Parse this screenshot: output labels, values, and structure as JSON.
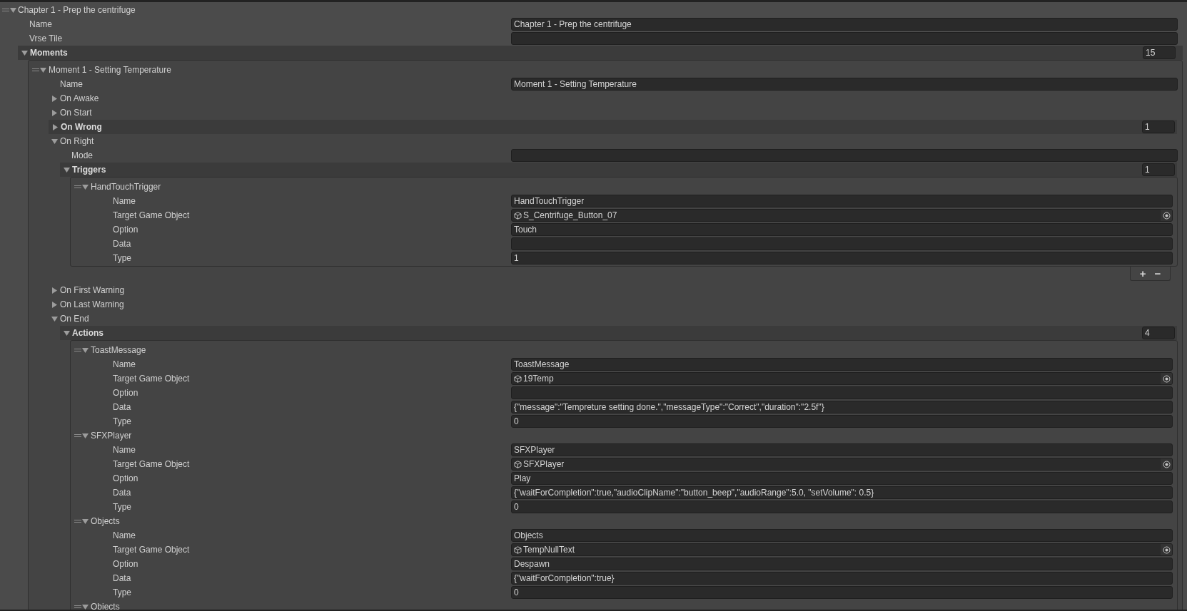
{
  "inspector": {
    "label": "Chapter 1 - Prep the centrifuge",
    "expanded": true,
    "children": [
      {
        "kind": "field",
        "label": "Name",
        "value": "Chapter 1 - Prep the centrifuge"
      },
      {
        "kind": "field",
        "label": "Vrse Tile"
      },
      {
        "kind": "list",
        "label": "Moments",
        "count": "15",
        "expanded": true,
        "items": [
          {
            "kind": "element",
            "label": "Moment 1 - Setting Temperature",
            "expanded": true,
            "children": [
              {
                "kind": "field",
                "label": "Name",
                "value": "Moment 1 - Setting Temperature"
              },
              {
                "kind": "foldout",
                "label": "On Awake",
                "expanded": false
              },
              {
                "kind": "foldout",
                "label": "On Start",
                "expanded": false
              },
              {
                "kind": "list",
                "label": "On Wrong",
                "count": "1",
                "expanded": false
              },
              {
                "kind": "foldout",
                "label": "On Right",
                "expanded": true,
                "children": [
                  {
                    "kind": "field",
                    "label": "Mode"
                  },
                  {
                    "kind": "list",
                    "label": "Triggers",
                    "count": "1",
                    "expanded": true,
                    "buttons": [
                      "+",
                      "−"
                    ],
                    "items": [
                      {
                        "kind": "element",
                        "label": "HandTouchTrigger",
                        "expanded": true,
                        "children": [
                          {
                            "kind": "field",
                            "label": "Name",
                            "value": "HandTouchTrigger"
                          },
                          {
                            "kind": "object",
                            "label": "Target Game Object",
                            "value": "S_Centrifuge_Button_07"
                          },
                          {
                            "kind": "field",
                            "label": "Option",
                            "value": "Touch"
                          },
                          {
                            "kind": "field",
                            "label": "Data"
                          },
                          {
                            "kind": "field",
                            "label": "Type",
                            "value": "1"
                          }
                        ]
                      }
                    ]
                  }
                ]
              },
              {
                "kind": "foldout",
                "label": "On First Warning",
                "expanded": false
              },
              {
                "kind": "foldout",
                "label": "On Last Warning",
                "expanded": false
              },
              {
                "kind": "foldout",
                "label": "On End",
                "expanded": true,
                "children": [
                  {
                    "kind": "list",
                    "label": "Actions",
                    "count": "4",
                    "expanded": true,
                    "items": [
                      {
                        "kind": "element",
                        "label": "ToastMessage",
                        "expanded": true,
                        "children": [
                          {
                            "kind": "field",
                            "label": "Name",
                            "value": "ToastMessage"
                          },
                          {
                            "kind": "object",
                            "label": "Target Game Object",
                            "value": "19Temp"
                          },
                          {
                            "kind": "field",
                            "label": "Option"
                          },
                          {
                            "kind": "field",
                            "label": "Data",
                            "value": "{\"message\":\"Tempreture setting done.\",\"messageType\":\"Correct\",\"duration\":\"2.5f\"}"
                          },
                          {
                            "kind": "field",
                            "label": "Type",
                            "value": "0"
                          }
                        ]
                      },
                      {
                        "kind": "element",
                        "label": "SFXPlayer",
                        "expanded": true,
                        "children": [
                          {
                            "kind": "field",
                            "label": "Name",
                            "value": "SFXPlayer"
                          },
                          {
                            "kind": "object",
                            "label": "Target Game Object",
                            "value": "SFXPlayer"
                          },
                          {
                            "kind": "field",
                            "label": "Option",
                            "value": "Play"
                          },
                          {
                            "kind": "field",
                            "label": "Data",
                            "value": "{\"waitForCompletion\":true,\"audioClipName\":\"button_beep\",\"audioRange\":5.0, \"setVolume\": 0.5}"
                          },
                          {
                            "kind": "field",
                            "label": "Type",
                            "value": "0"
                          }
                        ]
                      },
                      {
                        "kind": "element",
                        "label": "Objects",
                        "expanded": true,
                        "children": [
                          {
                            "kind": "field",
                            "label": "Name",
                            "value": "Objects"
                          },
                          {
                            "kind": "object",
                            "label": "Target Game Object",
                            "value": "TempNullText"
                          },
                          {
                            "kind": "field",
                            "label": "Option",
                            "value": "Despawn"
                          },
                          {
                            "kind": "field",
                            "label": "Data",
                            "value": "{\"waitForCompletion\":true}"
                          },
                          {
                            "kind": "field",
                            "label": "Type",
                            "value": "0"
                          }
                        ]
                      },
                      {
                        "kind": "element",
                        "label": "Objects",
                        "expanded": true
                      }
                    ]
                  }
                ]
              }
            ]
          }
        ]
      }
    ]
  }
}
